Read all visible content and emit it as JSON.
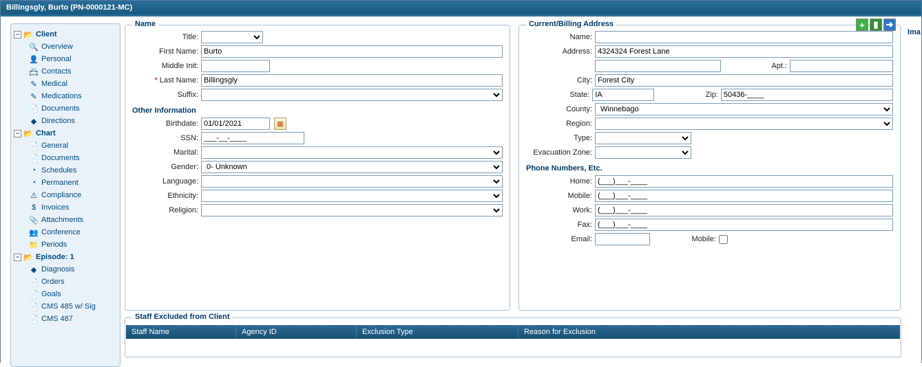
{
  "window_title": "Billingsgly, Burto (PN-0000121-MC)",
  "sidebar": {
    "client": {
      "label": "Client"
    },
    "client_items": [
      {
        "label": "Overview",
        "icon": "🔍"
      },
      {
        "label": "Personal",
        "icon": "👤"
      },
      {
        "label": "Contacts",
        "icon": "📇"
      },
      {
        "label": "Medical",
        "icon": "✎"
      },
      {
        "label": "Medications",
        "icon": "✎"
      },
      {
        "label": "Documents",
        "icon": "📄"
      },
      {
        "label": "Directions",
        "icon": "◆"
      }
    ],
    "chart": {
      "label": "Chart"
    },
    "chart_items": [
      {
        "label": "General",
        "icon": "📄"
      },
      {
        "label": "Documents",
        "icon": "📄"
      },
      {
        "label": "Schedules",
        "icon": "◔"
      },
      {
        "label": "Permanent",
        "icon": "◔"
      },
      {
        "label": "Compliance",
        "icon": "⚠"
      },
      {
        "label": "Invoices",
        "icon": "$"
      },
      {
        "label": "Attachments",
        "icon": "📎"
      },
      {
        "label": "Conference",
        "icon": "👥"
      },
      {
        "label": "Periods",
        "icon": "📁"
      }
    ],
    "episode": {
      "label": "Episode: 1"
    },
    "episode_items": [
      {
        "label": "Diagnosis",
        "icon": "◆"
      },
      {
        "label": "Orders",
        "icon": "📄"
      },
      {
        "label": "Goals",
        "icon": "📄"
      },
      {
        "label": "CMS 485 w/ Sig",
        "icon": "📄"
      },
      {
        "label": "CMS 487",
        "icon": "📄"
      }
    ]
  },
  "name_panel": {
    "legend": "Name",
    "title_label": "Title:",
    "first_name_label": "First Name:",
    "first_name_value": "Burto",
    "middle_label": "Middle Init:",
    "middle_value": "",
    "last_name_label": "Last Name:",
    "last_name_value": "Billingsgly",
    "suffix_label": "Suffix:",
    "other_info_title": "Other Information",
    "birthdate_label": "Birthdate:",
    "birthdate_value": "01/01/2021",
    "ssn_label": "SSN:",
    "ssn_value": "___-__-____",
    "marital_label": "Marital:",
    "gender_label": "Gender:",
    "gender_value": "0- Unknown",
    "language_label": "Language:",
    "ethnicity_label": "Ethnicity:",
    "religion_label": "Religion:"
  },
  "addr_panel": {
    "legend": "Current/Billing Address",
    "name_label": "Name:",
    "name_value": "",
    "address_label": "Address:",
    "address_value": "4324324 Forest Lane",
    "apt_label": "Apt.:",
    "apt_value": "",
    "city_label": "City:",
    "city_value": "Forest City",
    "state_label": "State:",
    "state_value": "IA",
    "zip_label": "Zip:",
    "zip_value": "50436-____",
    "county_label": "County:",
    "county_value": "Winnebago",
    "region_label": "Region:",
    "type_label": "Type:",
    "evac_label": "Evacuation Zone:",
    "phone_title": "Phone Numbers, Etc.",
    "home_label": "Home:",
    "home_value": "(___)___-____",
    "mobile_label": "Mobile:",
    "mobile_value": "(___)___-____",
    "work_label": "Work:",
    "work_value": "(___)___-____",
    "fax_label": "Fax:",
    "fax_value": "(___)___-____",
    "email_label": "Email:",
    "email_value": "",
    "mobile_chk_label": "Mobile:"
  },
  "img_tab": "Ima",
  "staff_panel": {
    "legend": "Staff Excluded from Client",
    "cols": [
      "Staff Name",
      "Agency ID",
      "Exclusion Type",
      "Reason for Exclusion"
    ]
  }
}
